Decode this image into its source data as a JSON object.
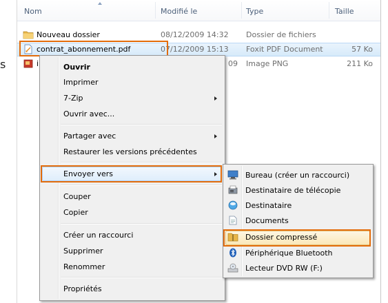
{
  "columns": {
    "name": "Nom",
    "modified": "Modifié le",
    "type": "Type",
    "size": "Taille"
  },
  "files": [
    {
      "name": "Nouveau dossier",
      "modified": "08/12/2009 14:32",
      "type": "Dossier de fichiers",
      "size": "",
      "icon": "folder-icon"
    },
    {
      "name": "contrat_abonnement.pdf",
      "modified": "07/12/2009 15:13",
      "type": "Foxit PDF Document",
      "size": "57 Ko",
      "icon": "pdf-file-icon"
    },
    {
      "name": "i",
      "modified": "09",
      "type": "Image PNG",
      "size": "211 Ko",
      "icon": "png-file-icon"
    }
  ],
  "stray_text": "s",
  "context_menu": {
    "items": [
      {
        "label": "Ouvrir",
        "bold": true
      },
      {
        "label": "Imprimer"
      },
      {
        "label": "7-Zip",
        "submenu": true
      },
      {
        "label": "Ouvrir avec..."
      },
      {
        "label": "Partager avec",
        "submenu": true
      },
      {
        "label": "Restaurer les versions précédentes"
      },
      {
        "label": "Envoyer vers",
        "submenu": true,
        "highlighted": true
      },
      {
        "label": "Couper"
      },
      {
        "label": "Copier"
      },
      {
        "label": "Créer un raccourci"
      },
      {
        "label": "Supprimer"
      },
      {
        "label": "Renommer"
      },
      {
        "label": "Propriétés"
      }
    ]
  },
  "send_to_menu": {
    "items": [
      {
        "label": "Bureau (créer un raccourci)",
        "icon": "desktop-icon"
      },
      {
        "label": "Destinataire de télécopie",
        "icon": "fax-icon"
      },
      {
        "label": "Destinataire",
        "icon": "mail-recipient-icon"
      },
      {
        "label": "Documents",
        "icon": "documents-icon"
      },
      {
        "label": "Dossier compressé",
        "icon": "zip-folder-icon",
        "highlighted": true
      },
      {
        "label": "Périphérique Bluetooth",
        "icon": "bluetooth-icon"
      },
      {
        "label": "Lecteur DVD RW (F:)",
        "icon": "dvd-drive-icon"
      }
    ]
  },
  "colors": {
    "highlight_box": "#e36c0a",
    "selection": "#d6eafa",
    "menu_bg": "#f0f0f0"
  }
}
